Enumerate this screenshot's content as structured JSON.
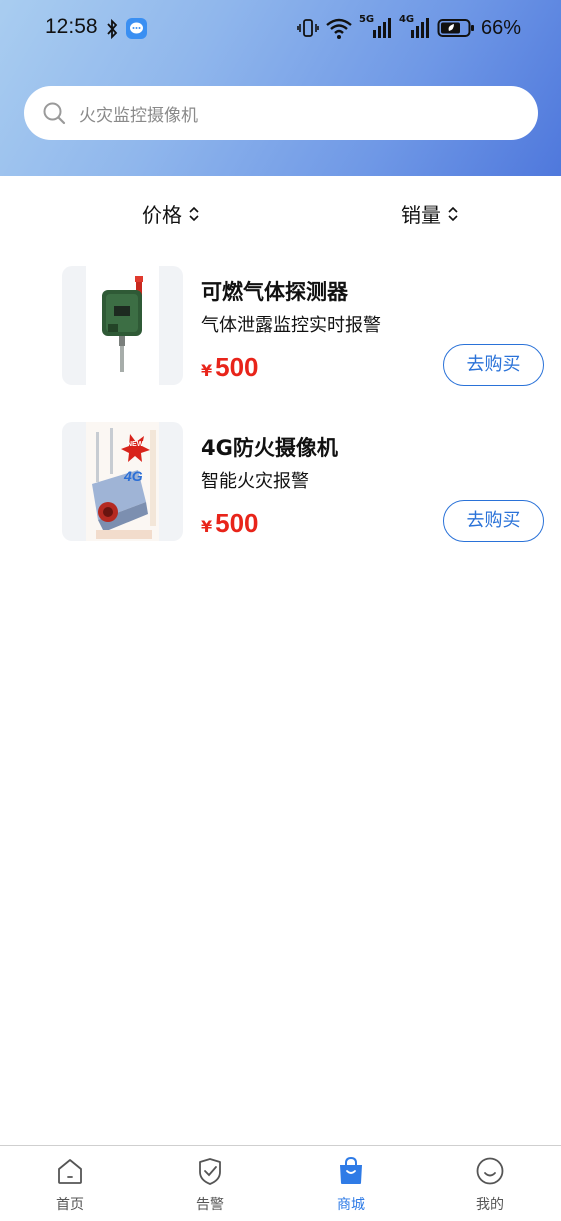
{
  "status_bar": {
    "time": "12:58",
    "battery": "66%",
    "net_labels": [
      "5G",
      "4G"
    ]
  },
  "search": {
    "placeholder": "火灾监控摄像机"
  },
  "sort": {
    "price_label": "价格",
    "sales_label": "销量"
  },
  "products": [
    {
      "title": "可燃气体探测器",
      "subtitle": "气体泄露监控实时报警",
      "currency": "¥",
      "price": "500",
      "buy_label": "去购买"
    },
    {
      "title": "4G防火摄像机",
      "subtitle": "智能火灾报警",
      "currency": "¥",
      "price": "500",
      "buy_label": "去购买",
      "image_badge_text": "NEW",
      "image_overlay_text": "4G"
    }
  ],
  "tabbar": {
    "items": [
      {
        "label": "首页",
        "icon": "home-icon"
      },
      {
        "label": "告警",
        "icon": "shield-check-icon"
      },
      {
        "label": "商城",
        "icon": "shopping-bag-icon"
      },
      {
        "label": "我的",
        "icon": "smile-icon"
      }
    ],
    "active_index": 2
  },
  "colors": {
    "accent": "#2f7be6",
    "price": "#e8241a",
    "header_gradient_start": "#a9cdf0",
    "header_gradient_end": "#4f78dc"
  }
}
